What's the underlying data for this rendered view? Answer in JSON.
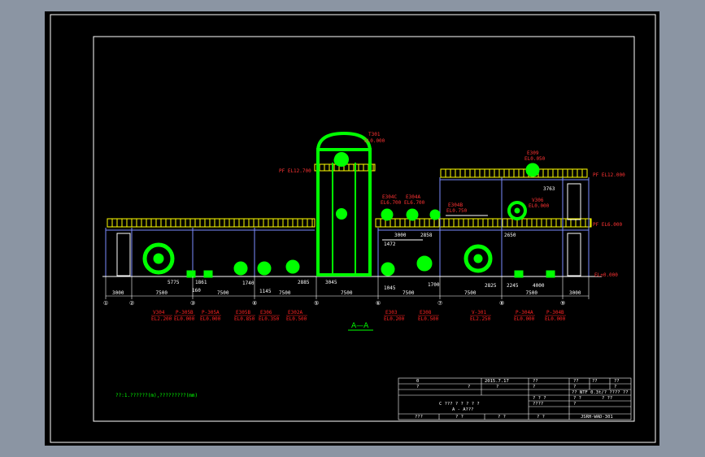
{
  "viewer": {
    "background": "#8b95a3",
    "sheet": "#000000"
  },
  "colors": {
    "equipment": "#00ff00",
    "platform": "#ffff00",
    "structure": "#ffffff",
    "elevation": "#ff3333",
    "columns": "#7b8bff",
    "dims": "#ffffff",
    "tags": "#ff2222",
    "note": "#00ff00"
  },
  "tags": {
    "t301": "T301",
    "t301_el": "EL0.000",
    "e309": "E309",
    "e309_el": "EL0.050",
    "e304c": "E304C",
    "e304c_el": "EL6.700",
    "e304a": "E304A",
    "e304a_el": "EL6.700",
    "e304b": "E304B",
    "e304b_el": "EL0.750",
    "v306": "V306",
    "v306_el": "EL0.000"
  },
  "elevations": {
    "pf_12700": "PF EL12.700",
    "pf_12000": "PF EL12.000",
    "pf_6000": "PF EL6.000",
    "el_0": "EL±0.000"
  },
  "grid_numbers": [
    "①",
    "②",
    "③",
    "④",
    "⑤",
    "⑥",
    "⑦",
    "⑧",
    "⑨"
  ],
  "dims_bottom": [
    "3000",
    "7500",
    "7500",
    "7500",
    "7500",
    "7500",
    "7500",
    "7500",
    "3000"
  ],
  "dims_inner": {
    "d5775": "5775",
    "d1861": "1861",
    "d160": "160",
    "d1740": "1740",
    "d1145": "1145",
    "d2885": "2885",
    "d3045": "3045",
    "d3000": "3000",
    "d2858": "2858",
    "d1472": "1472",
    "d1045": "1045",
    "d1700": "1700",
    "d2825": "2825",
    "d2245": "2245",
    "d4000": "4000",
    "d3763": "3763",
    "d2650": "2650"
  },
  "equipment_below": [
    {
      "tag": "V304",
      "el": "EL2.200"
    },
    {
      "tag": "P-305B",
      "el": "EL0.000"
    },
    {
      "tag": "P-305A",
      "el": "EL0.000"
    },
    {
      "tag": "E305B",
      "el": "EL0.850"
    },
    {
      "tag": "E306",
      "el": "EL0.350"
    },
    {
      "tag": "E302A",
      "el": "EL0.500"
    },
    {
      "tag": "E303",
      "el": "EL0.200"
    },
    {
      "tag": "E308",
      "el": "EL0.500"
    },
    {
      "tag": "V-301",
      "el": "EL2.250"
    },
    {
      "tag": "P-304A",
      "el": "EL0.000"
    },
    {
      "tag": "P-304B",
      "el": "EL0.000"
    }
  ],
  "section_label": "A—A",
  "note": "??:1.??????(m),?????????(mm)",
  "title_block": {
    "r1": [
      "0",
      "2015.7.17",
      "??",
      "??",
      "??",
      "??"
    ],
    "r2": [
      "?",
      "?",
      "?",
      "?",
      "?",
      "?"
    ],
    "r3_right": "?? NTF 0.3t/? ???? ??",
    "title": "C ??? ? ? ? ? ?",
    "subtitle": "A - A???",
    "r4": [
      "? ? ?",
      "? ?",
      "? ??"
    ],
    "r5": [
      "????",
      "?"
    ],
    "sign": [
      "???",
      "? ?",
      "? ?",
      "? ?"
    ],
    "drawing_no": "JSRH-WAD-301"
  }
}
